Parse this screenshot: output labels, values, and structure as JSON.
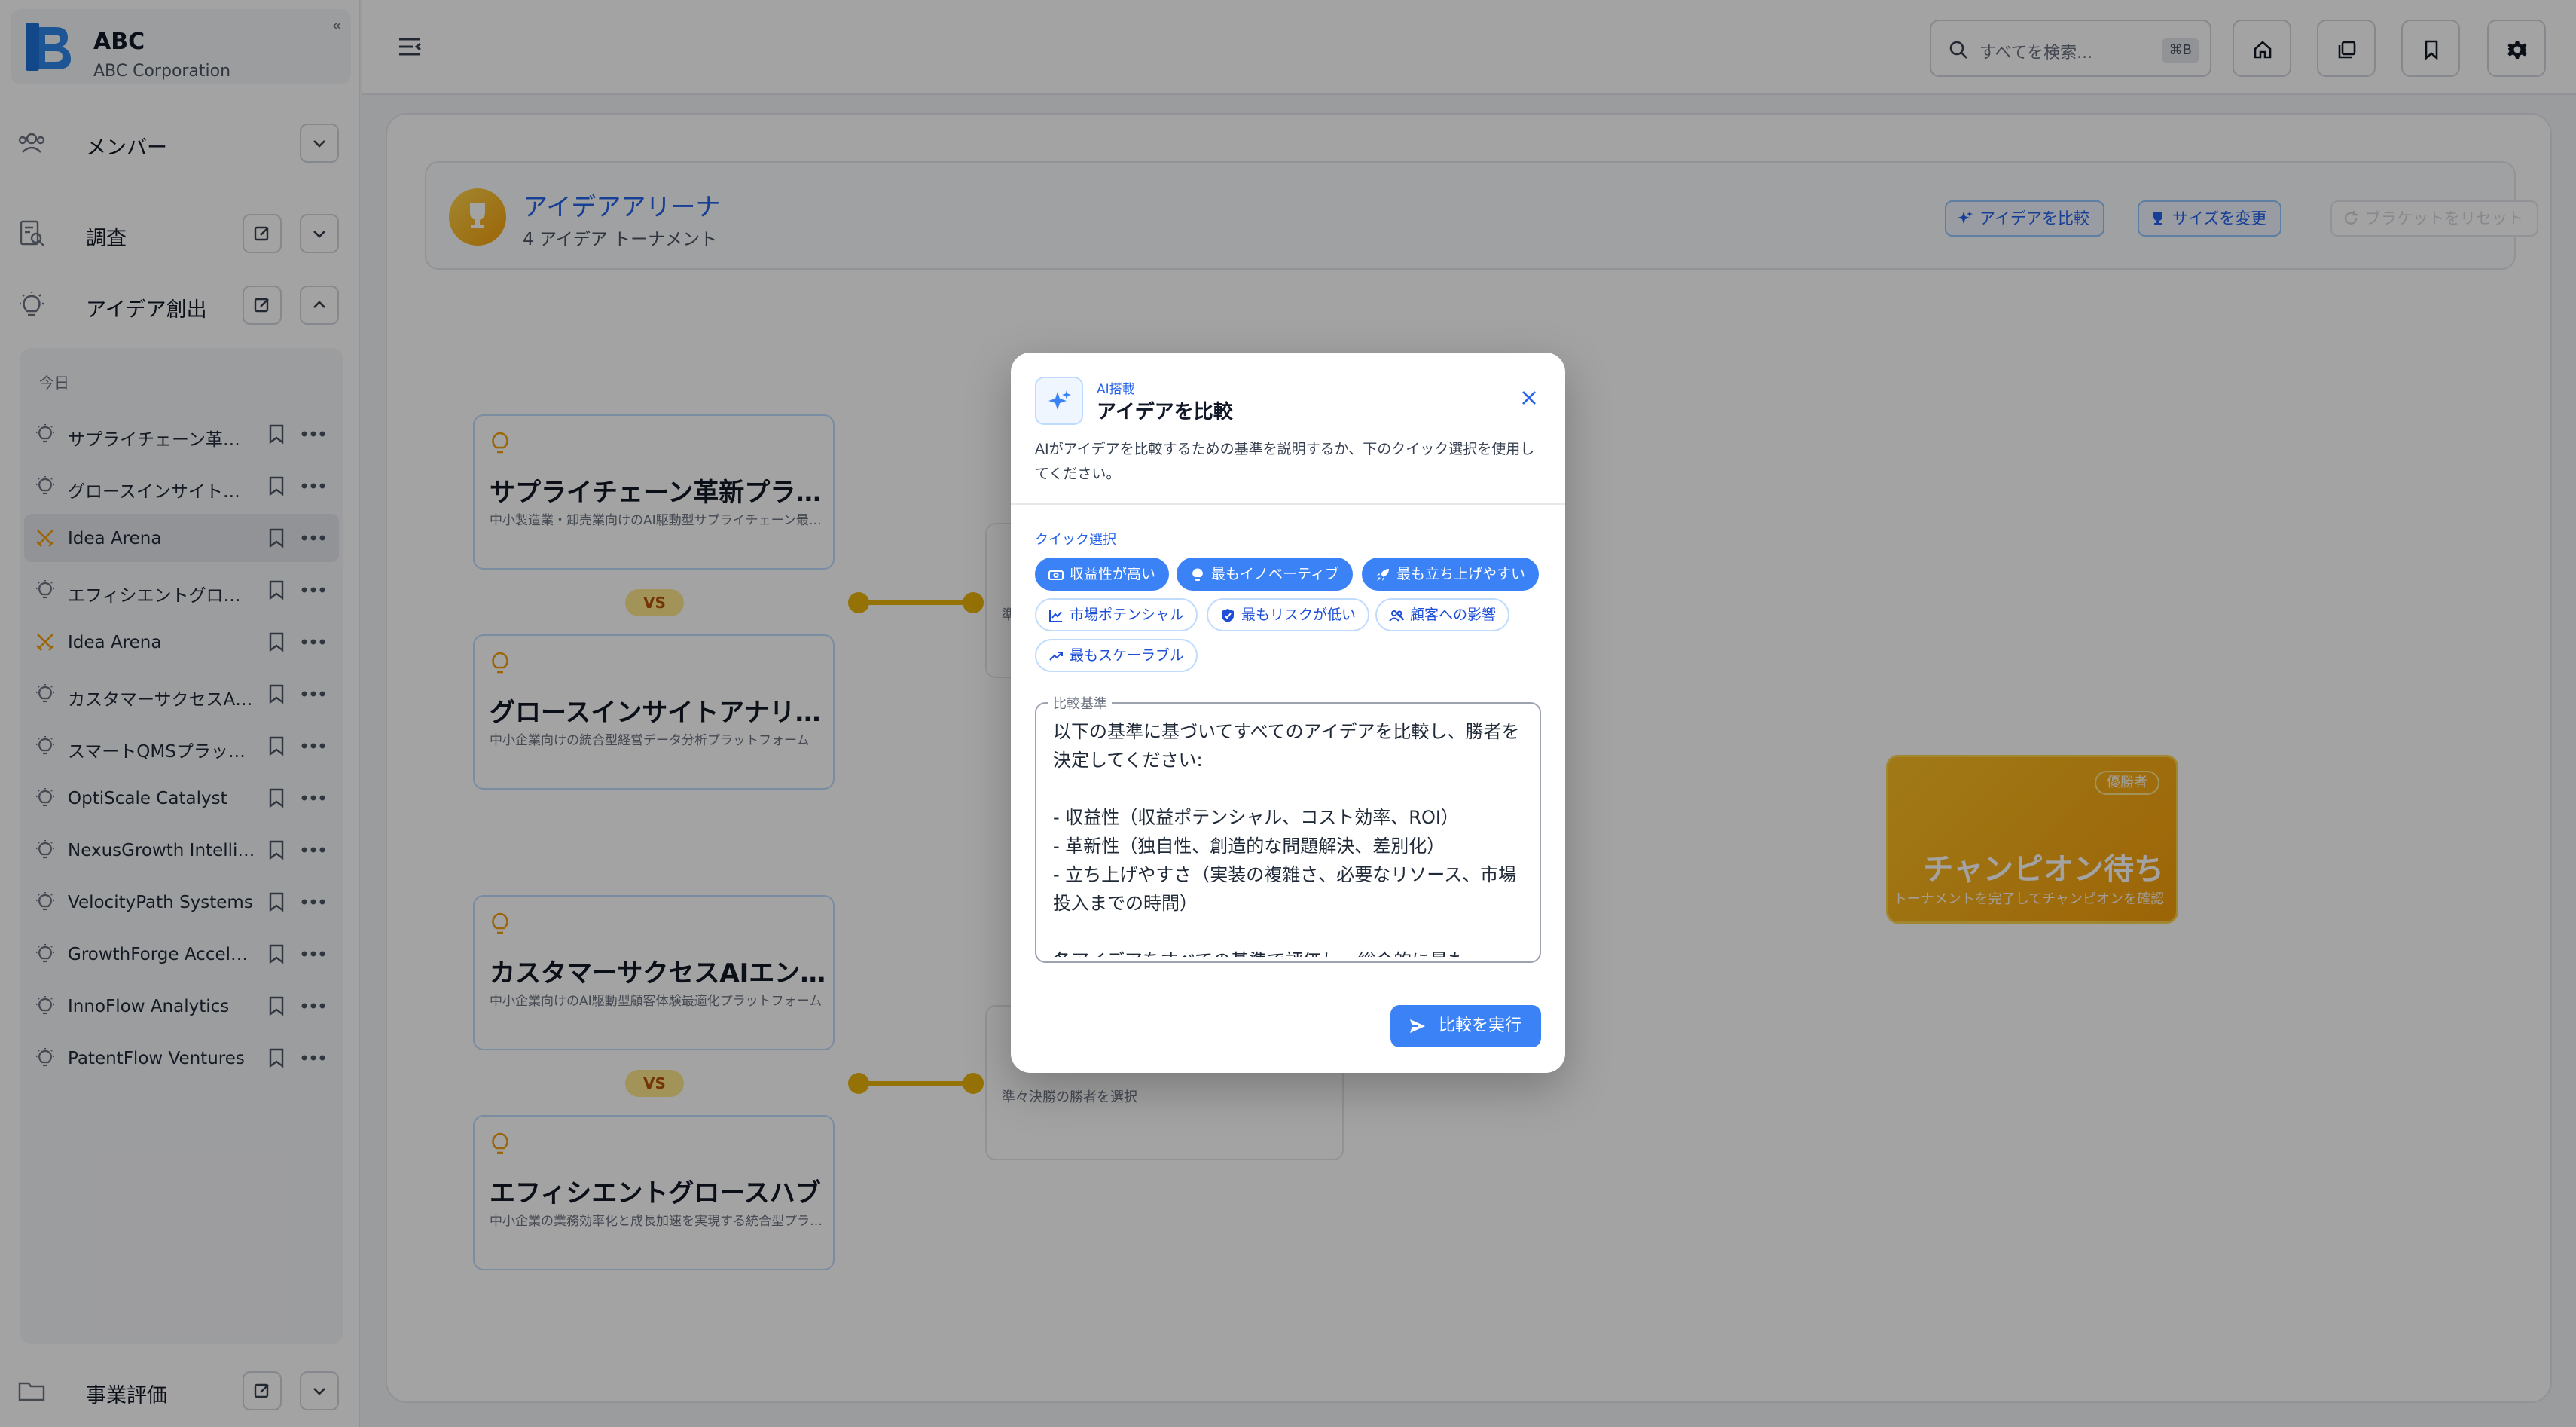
{
  "brand": {
    "name": "ABC",
    "company": "ABC Corporation",
    "collapse": "«"
  },
  "sidebar": {
    "sections": [
      {
        "label": "メンバー",
        "icon": "users-icon"
      },
      {
        "label": "調査",
        "icon": "search-document-icon"
      },
      {
        "label": "アイデア創出",
        "icon": "lightbulb-icon"
      },
      {
        "label": "事業評価",
        "icon": "folder-icon"
      }
    ],
    "day_label": "今日",
    "items": [
      {
        "label": "サプライチェーン革新プラットフォーム",
        "icon": "lightbulb-icon",
        "active": false
      },
      {
        "label": "グロースインサイトアナリティクス",
        "icon": "lightbulb-icon",
        "active": false
      },
      {
        "label": "Idea Arena",
        "icon": "crossed-swords-icon",
        "active": true
      },
      {
        "label": "エフィシエントグロースハブ",
        "icon": "lightbulb-icon",
        "active": false
      },
      {
        "label": "Idea Arena",
        "icon": "crossed-swords-icon",
        "active": false
      },
      {
        "label": "カスタマーサクセスAIエンジン",
        "icon": "lightbulb-icon",
        "active": false
      },
      {
        "label": "スマートQMSプラットフォーム",
        "icon": "lightbulb-icon",
        "active": false
      },
      {
        "label": "OptiScale Catalyst",
        "icon": "lightbulb-icon",
        "active": false
      },
      {
        "label": "NexusGrowth Intelligence",
        "icon": "lightbulb-icon",
        "active": false
      },
      {
        "label": "VelocityPath Systems",
        "icon": "lightbulb-icon",
        "active": false
      },
      {
        "label": "GrowthForge Accelerator",
        "icon": "lightbulb-icon",
        "active": false
      },
      {
        "label": "InnoFlow Analytics",
        "icon": "lightbulb-icon",
        "active": false
      },
      {
        "label": "PatentFlow Ventures",
        "icon": "lightbulb-icon",
        "active": false
      }
    ]
  },
  "topbar": {
    "search_placeholder": "すべてを検索...",
    "search_shortcut": "⌘B",
    "buttons": [
      "home-icon",
      "layers-icon",
      "bookmark-icon",
      "gear-icon"
    ]
  },
  "arena": {
    "title": "アイデアアリーナ",
    "subtitle": "4 アイデア トーナメント",
    "compare_btn": "アイデアを比較",
    "resize_btn": "サイズを変更",
    "reset_btn": "ブラケットをリセット",
    "vs_label": "VS",
    "cards": [
      {
        "title": "サプライチェーン革新プラットフォーム",
        "desc": "中小製造業・卸売業向けのAI駆動型サプライチェーン最適化プラットフォーム"
      },
      {
        "title": "グロースインサイトアナリティクス",
        "desc": "中小企業向けの統合型経営データ分析プラットフォーム"
      },
      {
        "title": "カスタマーサクセスAIエンジン",
        "desc": "中小企業向けのAI駆動型顧客体験最適化プラットフォーム"
      },
      {
        "title": "エフィシエントグロースハブ",
        "desc": "中小企業の業務効率化と成長加速を実現する統合型プラットフォーム"
      }
    ],
    "semi_top_text": "準",
    "semi_bottom_text": "準々決勝の勝者を選択",
    "champion_badge": "優勝者",
    "champion_title": "チャンピオン待ち",
    "champion_sub": "トーナメントを完了してチャンピオンを確認"
  },
  "modal": {
    "tag": "AI搭載",
    "title": "アイデアを比較",
    "description": "AIがアイデアを比較するための基準を説明するか、下のクイック選択を使用してください。",
    "quick_label": "クイック選択",
    "chips": [
      {
        "label": "収益性が高い",
        "icon": "money-icon",
        "selected": true
      },
      {
        "label": "最もイノベーティブ",
        "icon": "lightbulb-icon",
        "selected": true
      },
      {
        "label": "最も立ち上げやすい",
        "icon": "rocket-icon",
        "selected": true
      },
      {
        "label": "市場ポテンシャル",
        "icon": "chart-icon",
        "selected": false
      },
      {
        "label": "最もリスクが低い",
        "icon": "shield-icon",
        "selected": false
      },
      {
        "label": "顧客への影響",
        "icon": "users-icon",
        "selected": false
      },
      {
        "label": "最もスケーラブル",
        "icon": "trending-up-icon",
        "selected": false
      }
    ],
    "criteria_label": "比較基準",
    "criteria_text": "以下の基準に基づいてすべてのアイデアを比較し、勝者を決定してください:\n\n- 収益性（収益ポテンシャル、コスト効率、ROI）\n- 革新性（独自性、創造的な問題解決、差別化）\n- 立ち上げやすさ（実装の複雑さ、必要なリソース、市場投入までの時間）\n\n各アイデアをすべての基準で評価し、総合的に最も",
    "run_btn": "比較を実行"
  }
}
